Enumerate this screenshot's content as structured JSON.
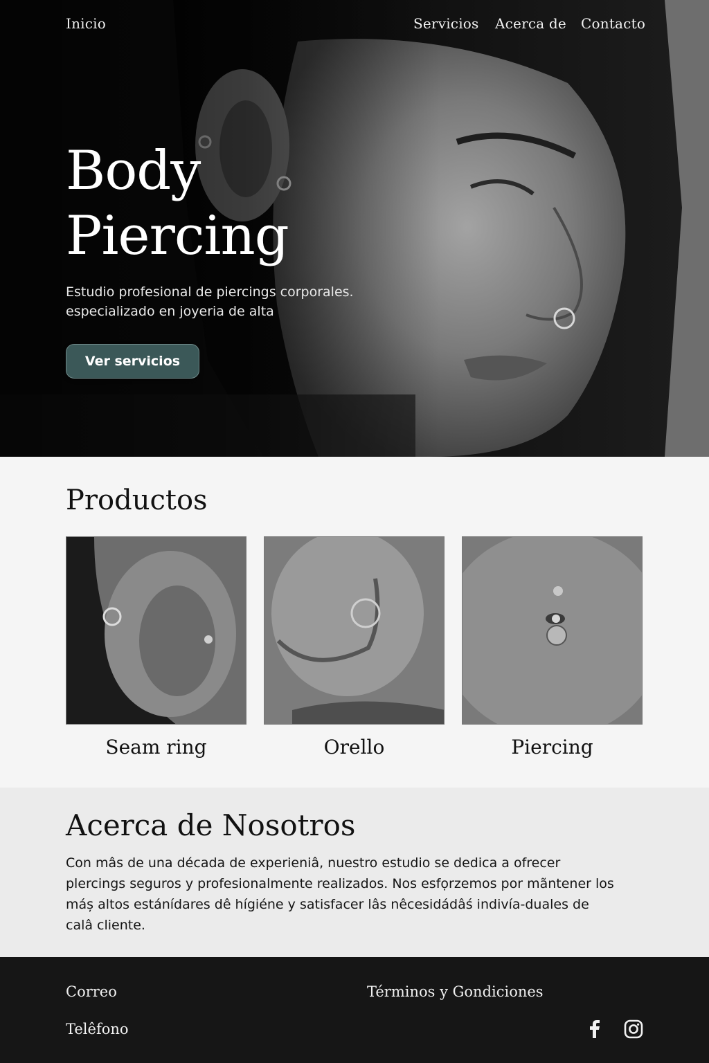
{
  "nav": {
    "home": "Inicio",
    "services": "Servicios",
    "about": "Acerca de",
    "contact": "Contacto"
  },
  "hero": {
    "title_line1": "Body",
    "title_line2": "Piercing",
    "subtitle_line1": "Estudio profesional de piercings corporales.",
    "subtitle_line2": "especializado en joyeria de alta",
    "cta": "Ver servicios"
  },
  "products": {
    "title": "Productos",
    "items": [
      {
        "label": "Seam ring"
      },
      {
        "label": "Orello"
      },
      {
        "label": "Piercing"
      }
    ]
  },
  "about": {
    "title": "Acerca de Nosotros",
    "text": "Con mâs de una década de experieniâ, nuestro estudio se dedica a ofrecer plercings seguros y profesionalmente realizados. Nos esfọrzemos por mãntener los máș altos estánídares dê hígiéne y satisfacer lâs nêcesidádâś indivía-duales de calâ cliente."
  },
  "footer": {
    "email": "Correo",
    "phone": "Telêfono",
    "terms": "Términos y Gondiciones"
  },
  "icons": {
    "facebook": "facebook-icon",
    "instagram": "instagram-icon"
  },
  "colors": {
    "accent_button": "#3b5858",
    "footer_bg": "#161616",
    "about_bg": "#ebebeb"
  }
}
